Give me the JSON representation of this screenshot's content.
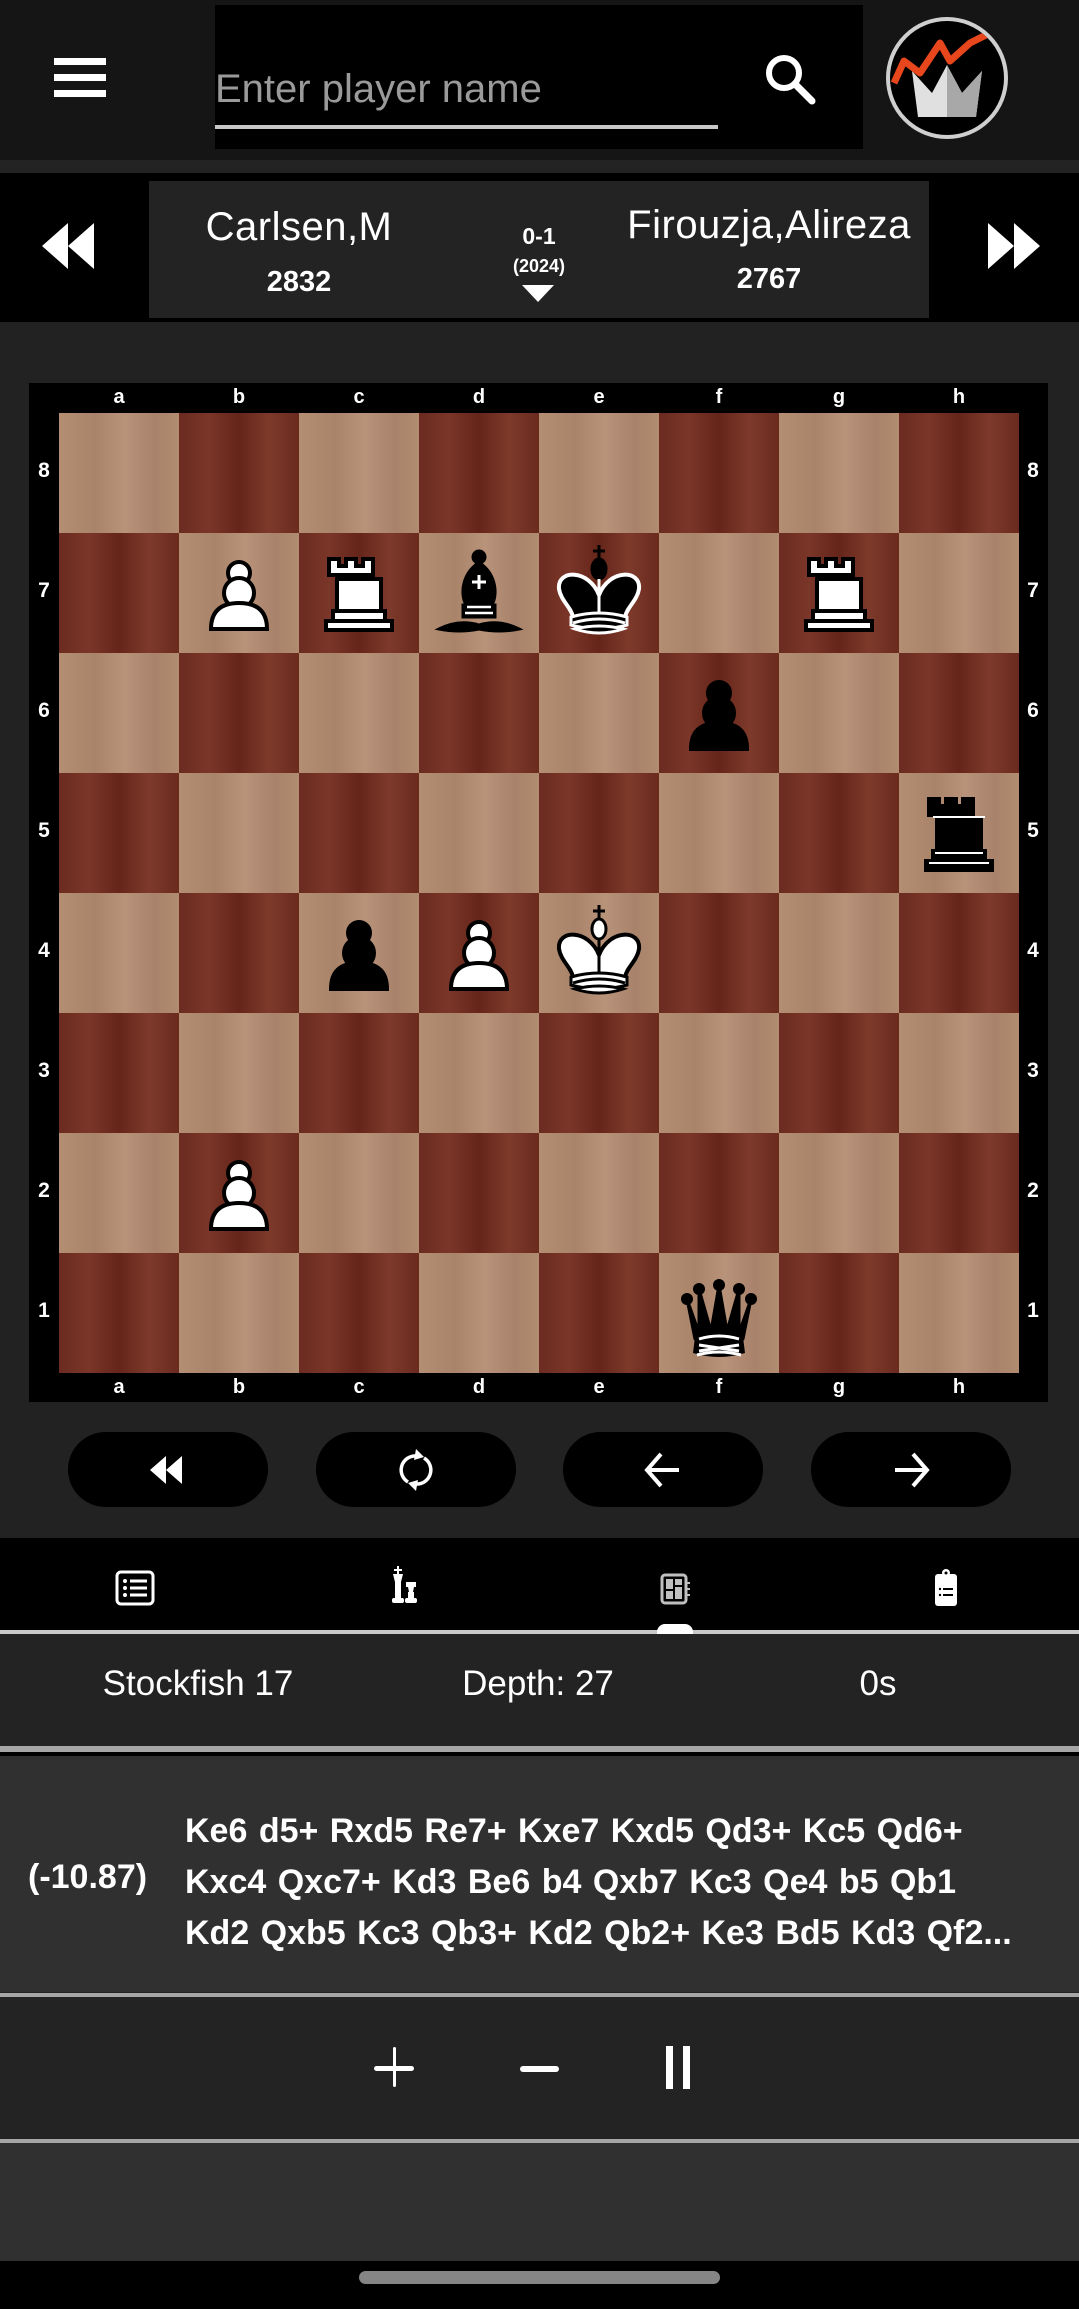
{
  "header": {
    "search_placeholder": "Enter player name",
    "search_value": "",
    "icons": {
      "menu": "hamburger-menu-icon",
      "search": "search-icon",
      "logo": "crown-trend-logo"
    }
  },
  "game": {
    "white_player": "Carlsen,M",
    "white_elo": "2832",
    "black_player": "Firouzja,Alireza",
    "black_elo": "2767",
    "result": "0-1",
    "year": "(2024)"
  },
  "board": {
    "files": [
      "a",
      "b",
      "c",
      "d",
      "e",
      "f",
      "g",
      "h"
    ],
    "ranks": [
      "8",
      "7",
      "6",
      "5",
      "4",
      "3",
      "2",
      "1"
    ],
    "light_color": "#b08a6e",
    "dark_color": "#6e2e22",
    "pieces": [
      {
        "square": "b7",
        "color": "white",
        "type": "pawn"
      },
      {
        "square": "c7",
        "color": "white",
        "type": "rook"
      },
      {
        "square": "d7",
        "color": "black",
        "type": "bishop"
      },
      {
        "square": "e7",
        "color": "black",
        "type": "king"
      },
      {
        "square": "g7",
        "color": "white",
        "type": "rook"
      },
      {
        "square": "f6",
        "color": "black",
        "type": "pawn"
      },
      {
        "square": "h5",
        "color": "black",
        "type": "rook"
      },
      {
        "square": "c4",
        "color": "black",
        "type": "pawn"
      },
      {
        "square": "d4",
        "color": "white",
        "type": "pawn"
      },
      {
        "square": "e4",
        "color": "white",
        "type": "king"
      },
      {
        "square": "b2",
        "color": "white",
        "type": "pawn"
      },
      {
        "square": "f1",
        "color": "black",
        "type": "queen"
      }
    ]
  },
  "controls": [
    {
      "name": "first-move-button",
      "icon": "rewind-icon"
    },
    {
      "name": "flip-board-button",
      "icon": "rotate-icon"
    },
    {
      "name": "previous-move-button",
      "icon": "arrow-left-icon"
    },
    {
      "name": "next-move-button",
      "icon": "arrow-right-icon"
    }
  ],
  "tabs": [
    {
      "name": "tab-moves",
      "icon": "list-icon",
      "active": false
    },
    {
      "name": "tab-games",
      "icon": "chess-pieces-icon",
      "active": false
    },
    {
      "name": "tab-engine",
      "icon": "engine-chip-icon",
      "active": true
    },
    {
      "name": "tab-notes",
      "icon": "clipboard-icon",
      "active": false
    }
  ],
  "engine": {
    "name": "Stockfish 17",
    "depth": "Depth: 27",
    "time": "0s",
    "evaluation": "(-10.87)",
    "pv_lines": [
      "Ke6 d5+ Rxd5 Re7+ Kxe7 Kxd5 Qd3+ Kc5 Qd6+",
      "Kxc4 Qxc7+ Kd3 Be6 b4 Qxb7 Kc3 Qe4 b5 Qb1",
      "Kd2 Qxb5 Kc3 Qb3+ Kd2 Qb2+ Ke3 Bd5 Kd3 Qf2..."
    ],
    "buttons": [
      {
        "name": "add-line-button",
        "icon": "plus-icon"
      },
      {
        "name": "remove-line-button",
        "icon": "minus-icon"
      },
      {
        "name": "pause-engine-button",
        "icon": "pause-icon"
      }
    ]
  }
}
